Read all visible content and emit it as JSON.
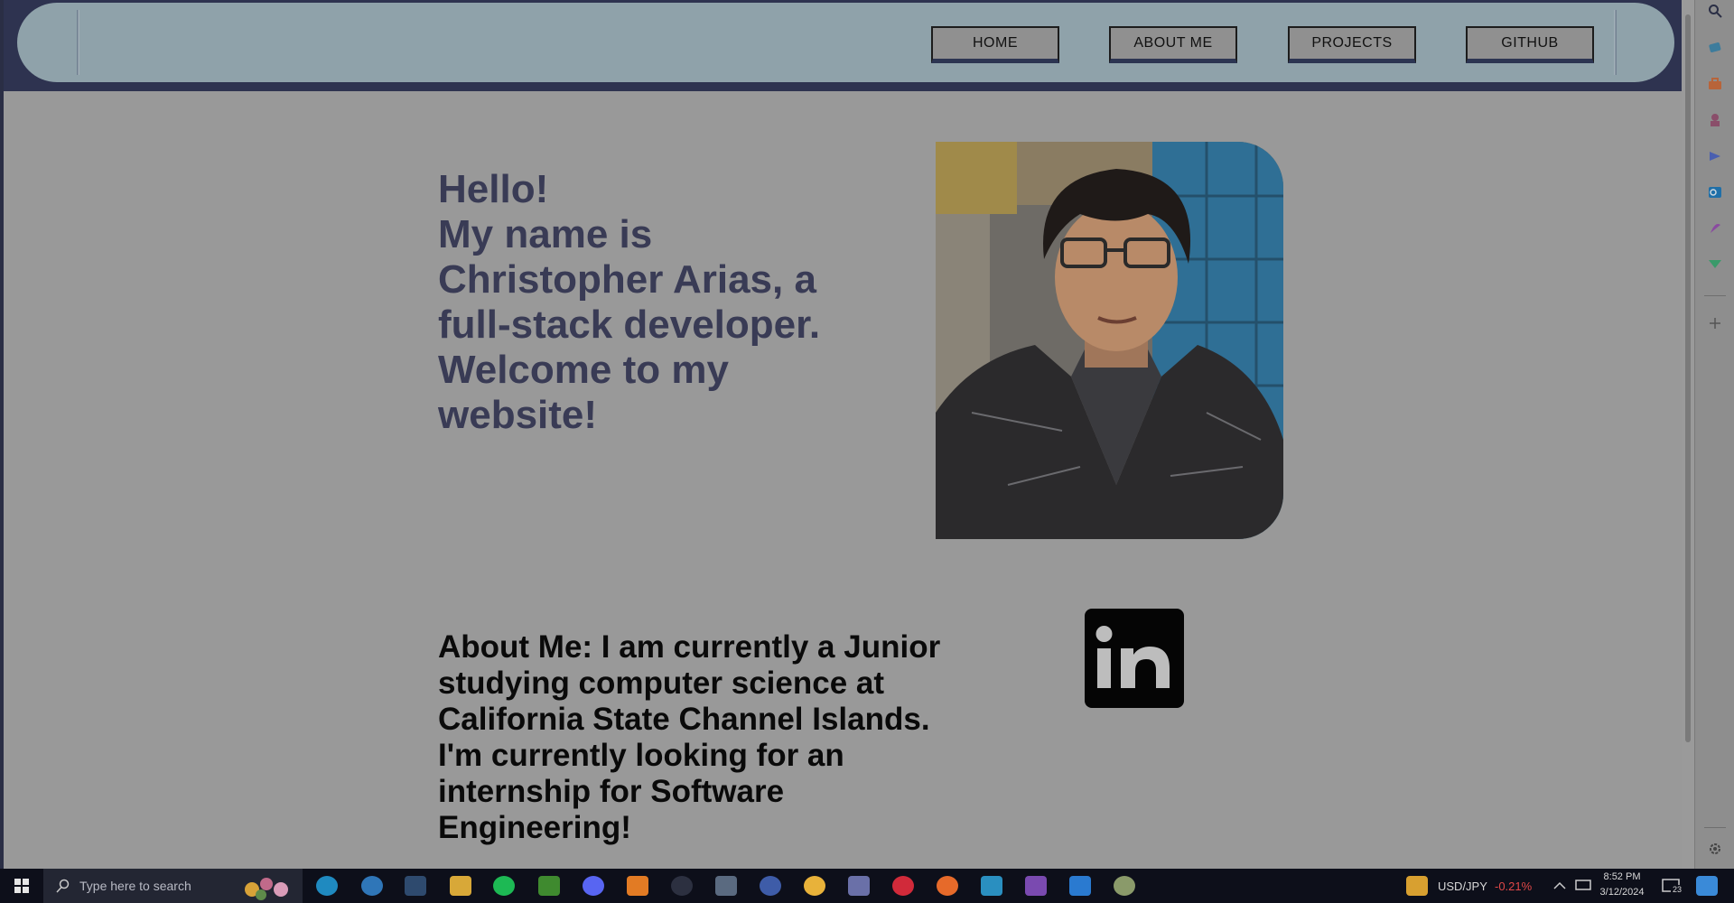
{
  "nav": {
    "items": [
      {
        "label": "HOME"
      },
      {
        "label": "ABOUT ME"
      },
      {
        "label": "PROJECTS"
      },
      {
        "label": "GITHUB"
      }
    ]
  },
  "hero": {
    "greeting": "Hello!\nMy name is\nChristopher Arias, a\nfull-stack developer.\nWelcome to my\nwebsite!"
  },
  "about": {
    "text": "About Me: I am currently a Junior studying computer science at California State Channel Islands. I'm currently looking for an internship for Software Engineering!"
  },
  "linkedin": {
    "label": "in"
  },
  "taskbar": {
    "search_placeholder": "Type here to search",
    "ticker_label": "USD/JPY",
    "ticker_change": "-0.21%",
    "time": "8:52 PM",
    "date": "3/12/2024",
    "notification_count": "23"
  },
  "colors": {
    "ticker_negative": "#e04848",
    "heading": "#393b55"
  }
}
